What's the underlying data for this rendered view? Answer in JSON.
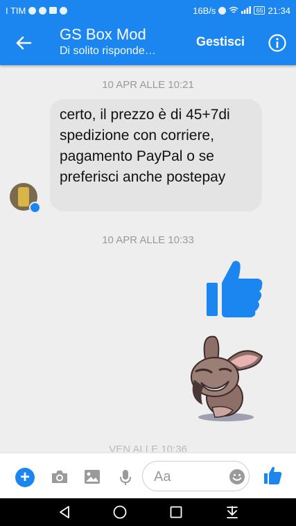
{
  "status_bar": {
    "carrier": "I TIM",
    "net_speed": "16B/s",
    "battery": "65",
    "time": "21:34"
  },
  "header": {
    "title": "GS Box Mod",
    "subtitle": "Di solito risponde…",
    "manage_label": "Gestisci"
  },
  "messages": {
    "timestamp_1": "10 APR ALLE 10:21",
    "bubble_text": "certo, il prezzo è di 45+7di spedizione con corriere, pagamento PayPal o se preferisci anche postepay",
    "timestamp_2": "10 APR ALLE 10:33",
    "timestamp_3_partial": "VEN ALLE 10:36"
  },
  "composer": {
    "placeholder": "Aa"
  },
  "colors": {
    "accent": "#1c86f0",
    "bubble": "#e4e4e4",
    "background": "#eeeeee"
  },
  "icons": {
    "back": "arrow-left-icon",
    "info": "info-icon",
    "plus": "plus-icon",
    "camera": "camera-icon",
    "gallery": "image-icon",
    "mic": "microphone-icon",
    "emoji": "emoji-icon",
    "like": "thumbs-up-icon"
  }
}
